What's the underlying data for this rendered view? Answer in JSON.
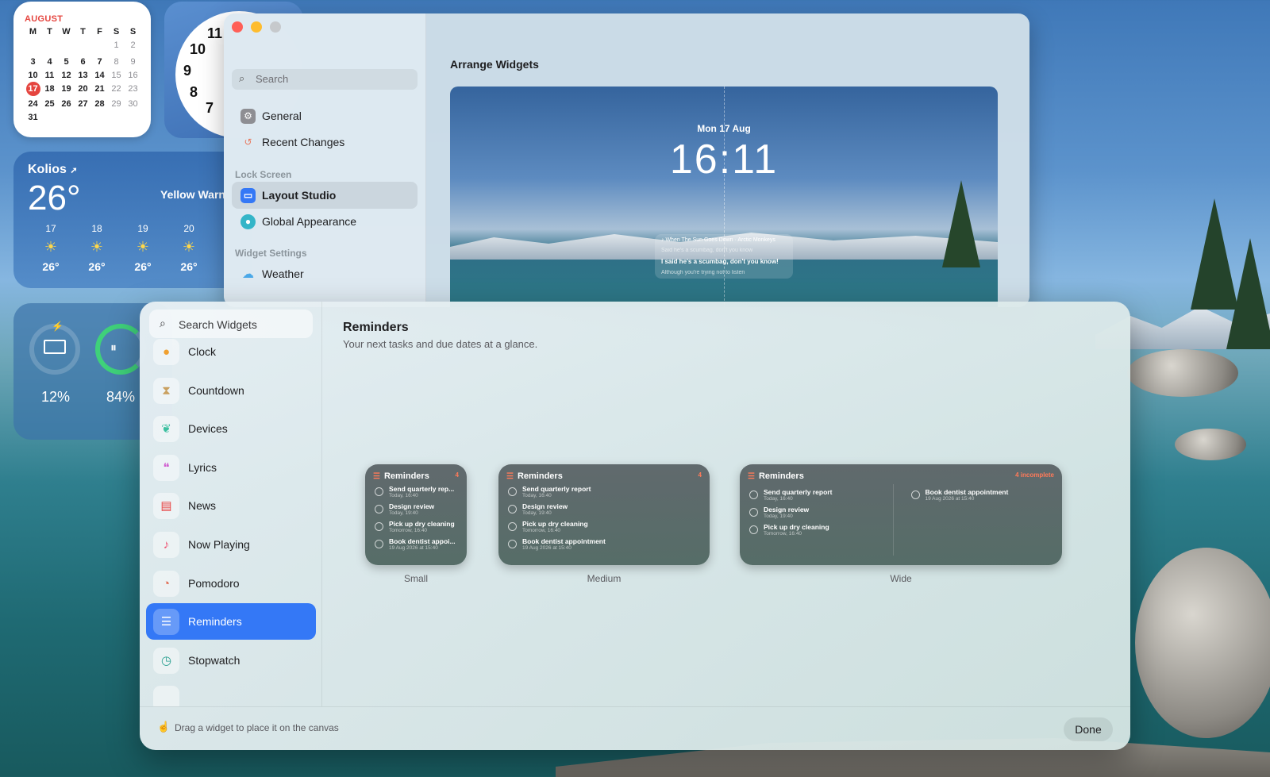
{
  "desktop": {
    "calendar": {
      "month": "AUGUST",
      "weekdays": [
        "M",
        "T",
        "W",
        "T",
        "F",
        "S",
        "S"
      ],
      "rows": [
        [
          "",
          "",
          "",
          "",
          "",
          "1",
          "2"
        ],
        [
          "3",
          "4",
          "5",
          "6",
          "7",
          "8",
          "9"
        ],
        [
          "10",
          "11",
          "12",
          "13",
          "14",
          "15",
          "16"
        ],
        [
          "17",
          "18",
          "19",
          "20",
          "21",
          "22",
          "23"
        ],
        [
          "24",
          "25",
          "26",
          "27",
          "28",
          "29",
          "30"
        ],
        [
          "31",
          "",
          "",
          "",
          "",
          "",
          ""
        ]
      ],
      "today": "17"
    },
    "clock": {
      "numbers": [
        "11",
        "10",
        "9",
        "8",
        "7"
      ]
    },
    "weather": {
      "city": "Kolios",
      "temp": "26°",
      "warning": "Yellow Warn",
      "days": [
        {
          "d": "17",
          "t": "26°"
        },
        {
          "d": "18",
          "t": "26°"
        },
        {
          "d": "19",
          "t": "26°"
        },
        {
          "d": "20",
          "t": "26°"
        }
      ]
    },
    "battery": {
      "laptop": "12%",
      "airpods": "84%"
    }
  },
  "settings": {
    "search_placeholder": "Search",
    "items_top": [
      {
        "label": "General",
        "icon": "gear-icon"
      },
      {
        "label": "Recent Changes",
        "icon": "clock-history-icon"
      }
    ],
    "lock_screen_header": "Lock Screen",
    "lock_items": [
      {
        "label": "Layout Studio",
        "icon": "layout-icon"
      },
      {
        "label": "Global Appearance",
        "icon": "palette-icon"
      }
    ],
    "widget_settings_header": "Widget Settings",
    "widget_items": [
      {
        "label": "Weather",
        "icon": "cloud-icon"
      }
    ],
    "arrange_title": "Arrange Widgets",
    "preview": {
      "date": "Mon 17 Aug",
      "time": "16:11",
      "lyrics": {
        "song": "When The Sun Goes Down",
        "artist": "Arctic Monkeys",
        "line1": "Said he's a scumbag, don't you know",
        "line2": "I said he's a scumbag, don't you know!",
        "line3": "Although you're trying not to listen"
      }
    }
  },
  "gallery": {
    "search_placeholder": "Search Widgets",
    "items": [
      {
        "label": "Clock",
        "icon": "clock-icon",
        "color": "#f0a030"
      },
      {
        "label": "Countdown",
        "icon": "hourglass-icon",
        "color": "#c9a060"
      },
      {
        "label": "Devices",
        "icon": "airpods-icon",
        "color": "#3cc0a0"
      },
      {
        "label": "Lyrics",
        "icon": "quote-icon",
        "color": "#d060d0"
      },
      {
        "label": "News",
        "icon": "newspaper-icon",
        "color": "#e84040"
      },
      {
        "label": "Now Playing",
        "icon": "music-note-icon",
        "color": "#f04a6a"
      },
      {
        "label": "Pomodoro",
        "icon": "timer-icon",
        "color": "#e06a50"
      },
      {
        "label": "Reminders",
        "icon": "list-icon",
        "color": "#ffffff"
      },
      {
        "label": "Stopwatch",
        "icon": "stopwatch-icon",
        "color": "#2aa090"
      }
    ],
    "selected": "Reminders",
    "title": "Reminders",
    "subtitle": "Your next tasks and due dates at a glance.",
    "footer_hint": "Drag a widget to place it on the canvas",
    "done_label": "Done",
    "widget_title": "Reminders",
    "sizes": [
      {
        "label": "Small",
        "count": "4",
        "tasks": [
          {
            "t": "Send quarterly rep...",
            "d": "Today, 16:40"
          },
          {
            "t": "Design review",
            "d": "Today, 19:40"
          },
          {
            "t": "Pick up dry cleaning",
            "d": "Tomorrow, 16:40"
          },
          {
            "t": "Book dentist appoi...",
            "d": "19 Aug 2026 at 15:40"
          }
        ]
      },
      {
        "label": "Medium",
        "count": "4",
        "tasks": [
          {
            "t": "Send quarterly report",
            "d": "Today, 16:40"
          },
          {
            "t": "Design review",
            "d": "Today, 19:40"
          },
          {
            "t": "Pick up dry cleaning",
            "d": "Tomorrow, 16:40"
          },
          {
            "t": "Book dentist appointment",
            "d": "19 Aug 2026 at 15:40"
          }
        ]
      },
      {
        "label": "Wide",
        "count": "4 incomplete",
        "tasks": [
          {
            "t": "Send quarterly report",
            "d": "Today, 16:40"
          },
          {
            "t": "Design review",
            "d": "Today, 19:40"
          },
          {
            "t": "Pick up dry cleaning",
            "d": "Tomorrow, 16:40"
          },
          {
            "t": "Book dentist appointment",
            "d": "19 Aug 2026 at 15:40"
          }
        ]
      }
    ]
  }
}
